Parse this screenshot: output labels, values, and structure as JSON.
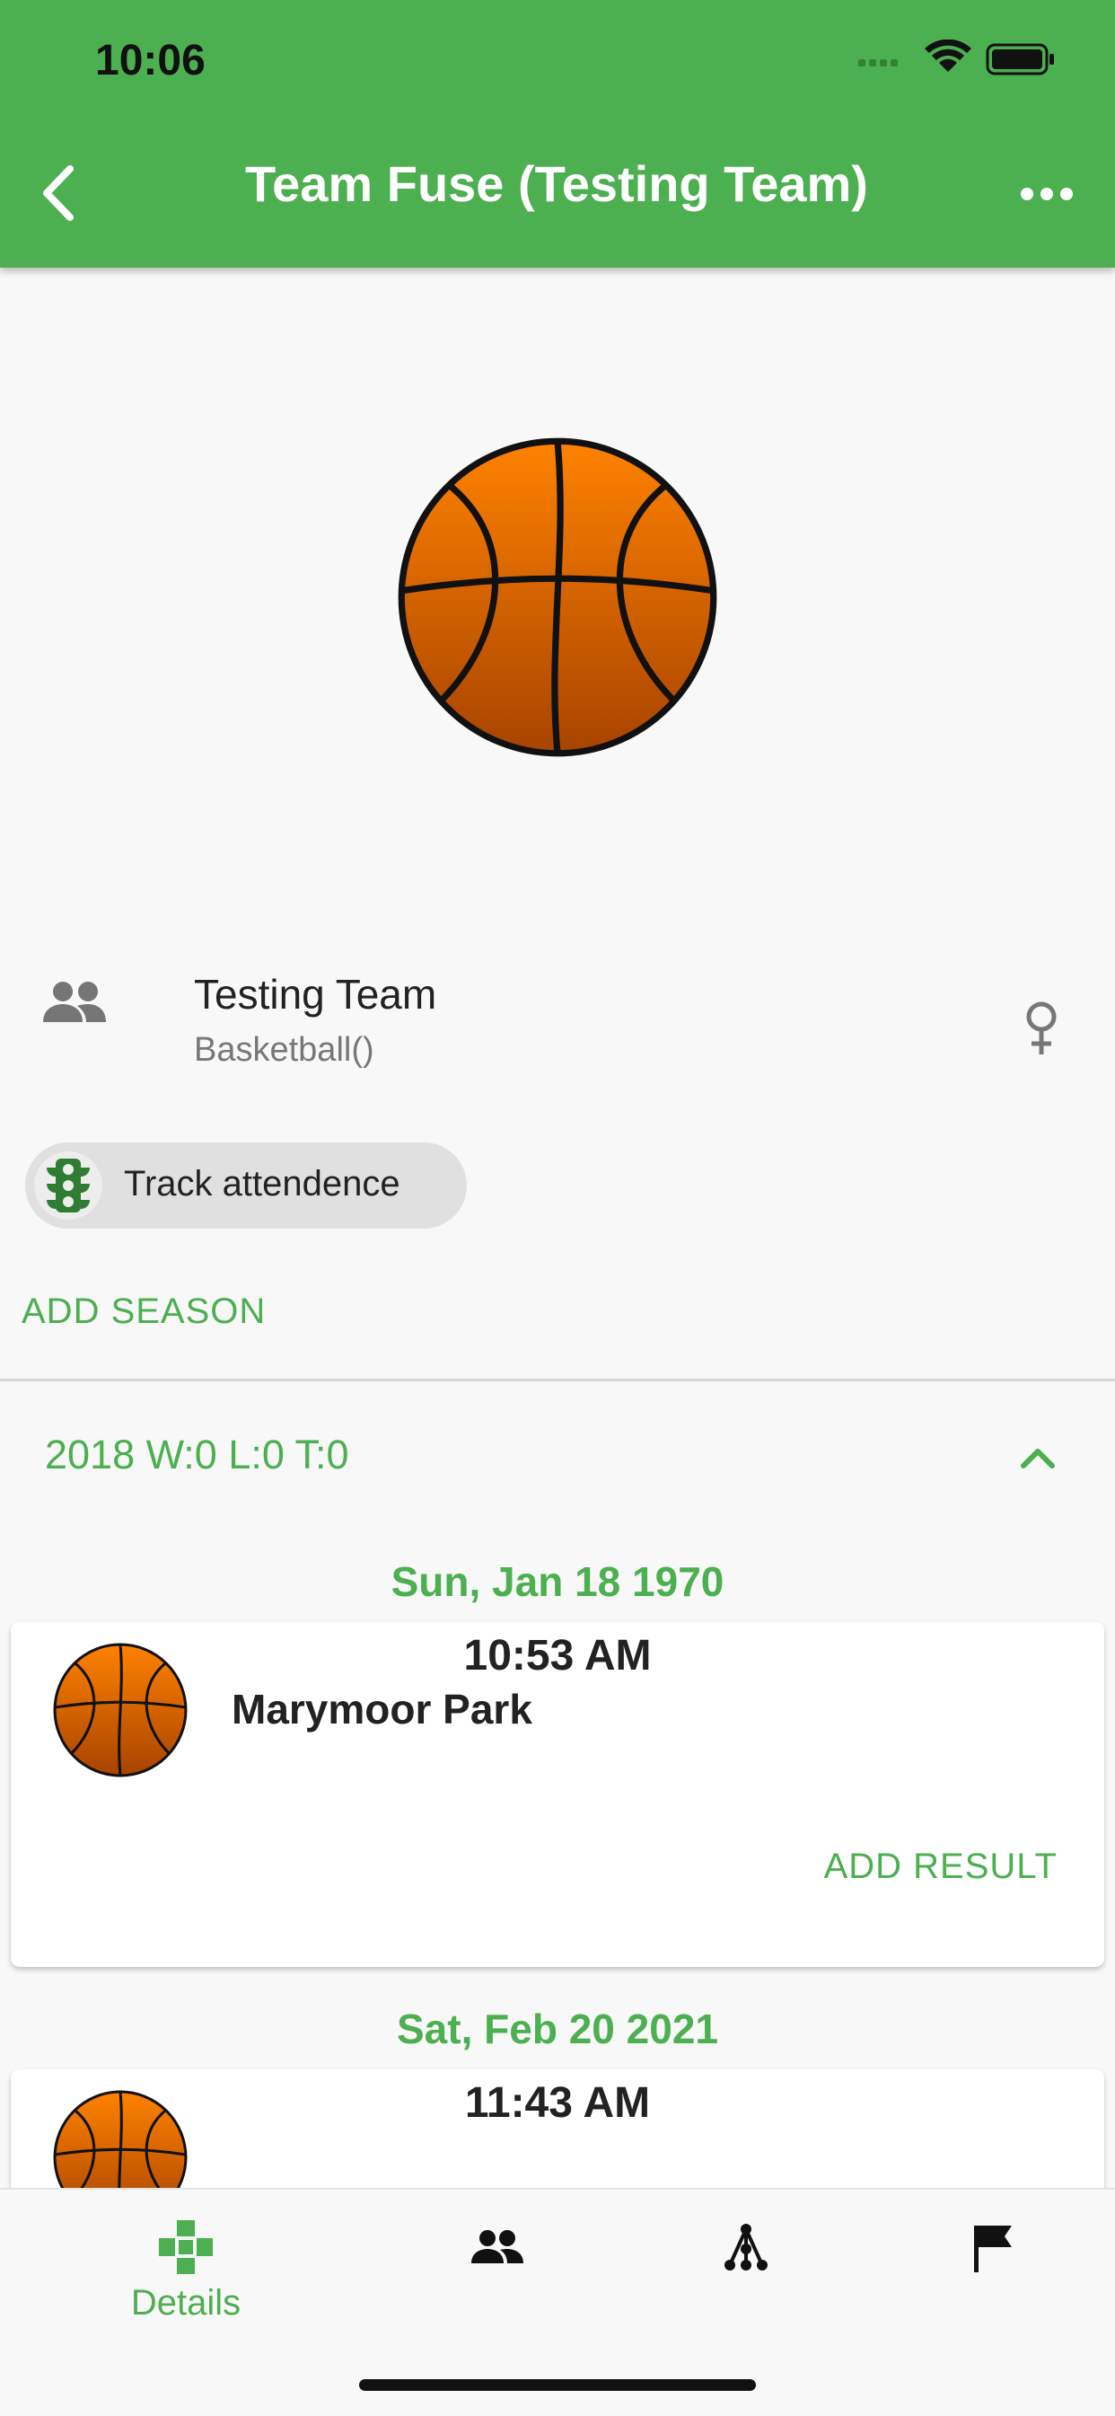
{
  "status_bar": {
    "time": "10:06"
  },
  "app_bar": {
    "title": "Team Fuse (Testing Team)"
  },
  "team": {
    "name": "Testing Team",
    "sport": "Basketball()"
  },
  "chip": {
    "label": "Track attendence"
  },
  "actions": {
    "add_season": "ADD SEASON"
  },
  "season": {
    "header": "2018 W:0 L:0 T:0"
  },
  "games": [
    {
      "date": "Sun, Jan 18 1970",
      "time": "10:53 AM",
      "place": "Marymoor Park",
      "action": "ADD RESULT"
    },
    {
      "date": "Sat, Feb 20 2021",
      "time": "11:43 AM"
    }
  ],
  "bottom_nav": {
    "items": [
      {
        "label": "Details",
        "icon": "details-icon",
        "active": true
      },
      {
        "label": "",
        "icon": "people-icon"
      },
      {
        "label": "",
        "icon": "tree-icon"
      },
      {
        "label": "",
        "icon": "flag-icon"
      }
    ]
  },
  "colors": {
    "accent": "#4caf50",
    "ball": "#f57c00"
  }
}
